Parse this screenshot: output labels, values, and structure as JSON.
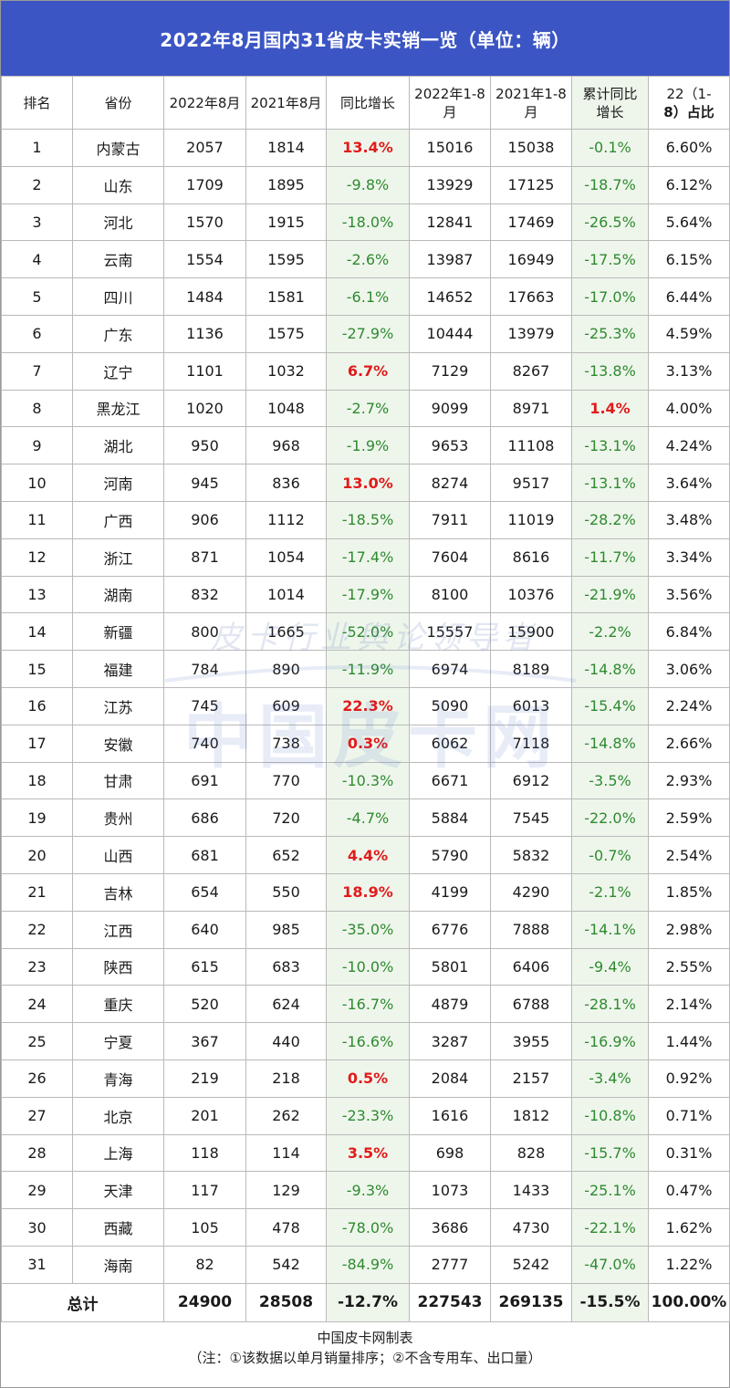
{
  "title": "2022年8月国内31省皮卡实销一览（单位：辆）",
  "headers": {
    "rank": "排名",
    "province": "省份",
    "aug2022": "2022年8月",
    "aug2021": "2021年8月",
    "yoy": "同比增长",
    "ytd2022_l1": "2022年1-8",
    "ytd2022_l2": "月",
    "ytd2021_l1": "2021年1-8",
    "ytd2021_l2": "月",
    "cum_l1": "累计同比",
    "cum_l2": "增长",
    "share_l1": "22（1-",
    "share_l2": "8）占比"
  },
  "rows": [
    {
      "rank": "1",
      "province": "内蒙古",
      "aug2022": "2057",
      "aug2021": "1814",
      "yoy": "13.4%",
      "yoy_up": true,
      "ytd2022": "15016",
      "ytd2021": "15038",
      "cum": "-0.1%",
      "cum_up": false,
      "share": "6.60%"
    },
    {
      "rank": "2",
      "province": "山东",
      "aug2022": "1709",
      "aug2021": "1895",
      "yoy": "-9.8%",
      "yoy_up": false,
      "ytd2022": "13929",
      "ytd2021": "17125",
      "cum": "-18.7%",
      "cum_up": false,
      "share": "6.12%"
    },
    {
      "rank": "3",
      "province": "河北",
      "aug2022": "1570",
      "aug2021": "1915",
      "yoy": "-18.0%",
      "yoy_up": false,
      "ytd2022": "12841",
      "ytd2021": "17469",
      "cum": "-26.5%",
      "cum_up": false,
      "share": "5.64%"
    },
    {
      "rank": "4",
      "province": "云南",
      "aug2022": "1554",
      "aug2021": "1595",
      "yoy": "-2.6%",
      "yoy_up": false,
      "ytd2022": "13987",
      "ytd2021": "16949",
      "cum": "-17.5%",
      "cum_up": false,
      "share": "6.15%"
    },
    {
      "rank": "5",
      "province": "四川",
      "aug2022": "1484",
      "aug2021": "1581",
      "yoy": "-6.1%",
      "yoy_up": false,
      "ytd2022": "14652",
      "ytd2021": "17663",
      "cum": "-17.0%",
      "cum_up": false,
      "share": "6.44%"
    },
    {
      "rank": "6",
      "province": "广东",
      "aug2022": "1136",
      "aug2021": "1575",
      "yoy": "-27.9%",
      "yoy_up": false,
      "ytd2022": "10444",
      "ytd2021": "13979",
      "cum": "-25.3%",
      "cum_up": false,
      "share": "4.59%"
    },
    {
      "rank": "7",
      "province": "辽宁",
      "aug2022": "1101",
      "aug2021": "1032",
      "yoy": "6.7%",
      "yoy_up": true,
      "ytd2022": "7129",
      "ytd2021": "8267",
      "cum": "-13.8%",
      "cum_up": false,
      "share": "3.13%"
    },
    {
      "rank": "8",
      "province": "黑龙江",
      "aug2022": "1020",
      "aug2021": "1048",
      "yoy": "-2.7%",
      "yoy_up": false,
      "ytd2022": "9099",
      "ytd2021": "8971",
      "cum": "1.4%",
      "cum_up": true,
      "share": "4.00%"
    },
    {
      "rank": "9",
      "province": "湖北",
      "aug2022": "950",
      "aug2021": "968",
      "yoy": "-1.9%",
      "yoy_up": false,
      "ytd2022": "9653",
      "ytd2021": "11108",
      "cum": "-13.1%",
      "cum_up": false,
      "share": "4.24%"
    },
    {
      "rank": "10",
      "province": "河南",
      "aug2022": "945",
      "aug2021": "836",
      "yoy": "13.0%",
      "yoy_up": true,
      "ytd2022": "8274",
      "ytd2021": "9517",
      "cum": "-13.1%",
      "cum_up": false,
      "share": "3.64%"
    },
    {
      "rank": "11",
      "province": "广西",
      "aug2022": "906",
      "aug2021": "1112",
      "yoy": "-18.5%",
      "yoy_up": false,
      "ytd2022": "7911",
      "ytd2021": "11019",
      "cum": "-28.2%",
      "cum_up": false,
      "share": "3.48%"
    },
    {
      "rank": "12",
      "province": "浙江",
      "aug2022": "871",
      "aug2021": "1054",
      "yoy": "-17.4%",
      "yoy_up": false,
      "ytd2022": "7604",
      "ytd2021": "8616",
      "cum": "-11.7%",
      "cum_up": false,
      "share": "3.34%"
    },
    {
      "rank": "13",
      "province": "湖南",
      "aug2022": "832",
      "aug2021": "1014",
      "yoy": "-17.9%",
      "yoy_up": false,
      "ytd2022": "8100",
      "ytd2021": "10376",
      "cum": "-21.9%",
      "cum_up": false,
      "share": "3.56%"
    },
    {
      "rank": "14",
      "province": "新疆",
      "aug2022": "800",
      "aug2021": "1665",
      "yoy": "-52.0%",
      "yoy_up": false,
      "ytd2022": "15557",
      "ytd2021": "15900",
      "cum": "-2.2%",
      "cum_up": false,
      "share": "6.84%"
    },
    {
      "rank": "15",
      "province": "福建",
      "aug2022": "784",
      "aug2021": "890",
      "yoy": "-11.9%",
      "yoy_up": false,
      "ytd2022": "6974",
      "ytd2021": "8189",
      "cum": "-14.8%",
      "cum_up": false,
      "share": "3.06%"
    },
    {
      "rank": "16",
      "province": "江苏",
      "aug2022": "745",
      "aug2021": "609",
      "yoy": "22.3%",
      "yoy_up": true,
      "ytd2022": "5090",
      "ytd2021": "6013",
      "cum": "-15.4%",
      "cum_up": false,
      "share": "2.24%"
    },
    {
      "rank": "17",
      "province": "安徽",
      "aug2022": "740",
      "aug2021": "738",
      "yoy": "0.3%",
      "yoy_up": true,
      "ytd2022": "6062",
      "ytd2021": "7118",
      "cum": "-14.8%",
      "cum_up": false,
      "share": "2.66%"
    },
    {
      "rank": "18",
      "province": "甘肃",
      "aug2022": "691",
      "aug2021": "770",
      "yoy": "-10.3%",
      "yoy_up": false,
      "ytd2022": "6671",
      "ytd2021": "6912",
      "cum": "-3.5%",
      "cum_up": false,
      "share": "2.93%"
    },
    {
      "rank": "19",
      "province": "贵州",
      "aug2022": "686",
      "aug2021": "720",
      "yoy": "-4.7%",
      "yoy_up": false,
      "ytd2022": "5884",
      "ytd2021": "7545",
      "cum": "-22.0%",
      "cum_up": false,
      "share": "2.59%"
    },
    {
      "rank": "20",
      "province": "山西",
      "aug2022": "681",
      "aug2021": "652",
      "yoy": "4.4%",
      "yoy_up": true,
      "ytd2022": "5790",
      "ytd2021": "5832",
      "cum": "-0.7%",
      "cum_up": false,
      "share": "2.54%"
    },
    {
      "rank": "21",
      "province": "吉林",
      "aug2022": "654",
      "aug2021": "550",
      "yoy": "18.9%",
      "yoy_up": true,
      "ytd2022": "4199",
      "ytd2021": "4290",
      "cum": "-2.1%",
      "cum_up": false,
      "share": "1.85%"
    },
    {
      "rank": "22",
      "province": "江西",
      "aug2022": "640",
      "aug2021": "985",
      "yoy": "-35.0%",
      "yoy_up": false,
      "ytd2022": "6776",
      "ytd2021": "7888",
      "cum": "-14.1%",
      "cum_up": false,
      "share": "2.98%"
    },
    {
      "rank": "23",
      "province": "陕西",
      "aug2022": "615",
      "aug2021": "683",
      "yoy": "-10.0%",
      "yoy_up": false,
      "ytd2022": "5801",
      "ytd2021": "6406",
      "cum": "-9.4%",
      "cum_up": false,
      "share": "2.55%"
    },
    {
      "rank": "24",
      "province": "重庆",
      "aug2022": "520",
      "aug2021": "624",
      "yoy": "-16.7%",
      "yoy_up": false,
      "ytd2022": "4879",
      "ytd2021": "6788",
      "cum": "-28.1%",
      "cum_up": false,
      "share": "2.14%"
    },
    {
      "rank": "25",
      "province": "宁夏",
      "aug2022": "367",
      "aug2021": "440",
      "yoy": "-16.6%",
      "yoy_up": false,
      "ytd2022": "3287",
      "ytd2021": "3955",
      "cum": "-16.9%",
      "cum_up": false,
      "share": "1.44%"
    },
    {
      "rank": "26",
      "province": "青海",
      "aug2022": "219",
      "aug2021": "218",
      "yoy": "0.5%",
      "yoy_up": true,
      "ytd2022": "2084",
      "ytd2021": "2157",
      "cum": "-3.4%",
      "cum_up": false,
      "share": "0.92%"
    },
    {
      "rank": "27",
      "province": "北京",
      "aug2022": "201",
      "aug2021": "262",
      "yoy": "-23.3%",
      "yoy_up": false,
      "ytd2022": "1616",
      "ytd2021": "1812",
      "cum": "-10.8%",
      "cum_up": false,
      "share": "0.71%"
    },
    {
      "rank": "28",
      "province": "上海",
      "aug2022": "118",
      "aug2021": "114",
      "yoy": "3.5%",
      "yoy_up": true,
      "ytd2022": "698",
      "ytd2021": "828",
      "cum": "-15.7%",
      "cum_up": false,
      "share": "0.31%"
    },
    {
      "rank": "29",
      "province": "天津",
      "aug2022": "117",
      "aug2021": "129",
      "yoy": "-9.3%",
      "yoy_up": false,
      "ytd2022": "1073",
      "ytd2021": "1433",
      "cum": "-25.1%",
      "cum_up": false,
      "share": "0.47%"
    },
    {
      "rank": "30",
      "province": "西藏",
      "aug2022": "105",
      "aug2021": "478",
      "yoy": "-78.0%",
      "yoy_up": false,
      "ytd2022": "3686",
      "ytd2021": "4730",
      "cum": "-22.1%",
      "cum_up": false,
      "share": "1.62%"
    },
    {
      "rank": "31",
      "province": "海南",
      "aug2022": "82",
      "aug2021": "542",
      "yoy": "-84.9%",
      "yoy_up": false,
      "ytd2022": "2777",
      "ytd2021": "5242",
      "cum": "-47.0%",
      "cum_up": false,
      "share": "1.22%"
    }
  ],
  "total": {
    "label": "总计",
    "aug2022": "24900",
    "aug2021": "28508",
    "yoy": "-12.7%",
    "ytd2022": "227543",
    "ytd2021": "269135",
    "cum": "-15.5%",
    "share": "100.00%"
  },
  "footer": {
    "maker": "中国皮卡网制表",
    "note": "（注：①该数据以单月销量排序；②不含专用车、出口量）"
  },
  "watermark": {
    "line1": "皮卡行业舆论领导者",
    "line2": "中国皮卡网"
  },
  "colors": {
    "title_bg": "#3b55c4",
    "highlight_bg": "#eef6ec",
    "positive": "#e11b1b",
    "negative": "#2f8a2f"
  }
}
